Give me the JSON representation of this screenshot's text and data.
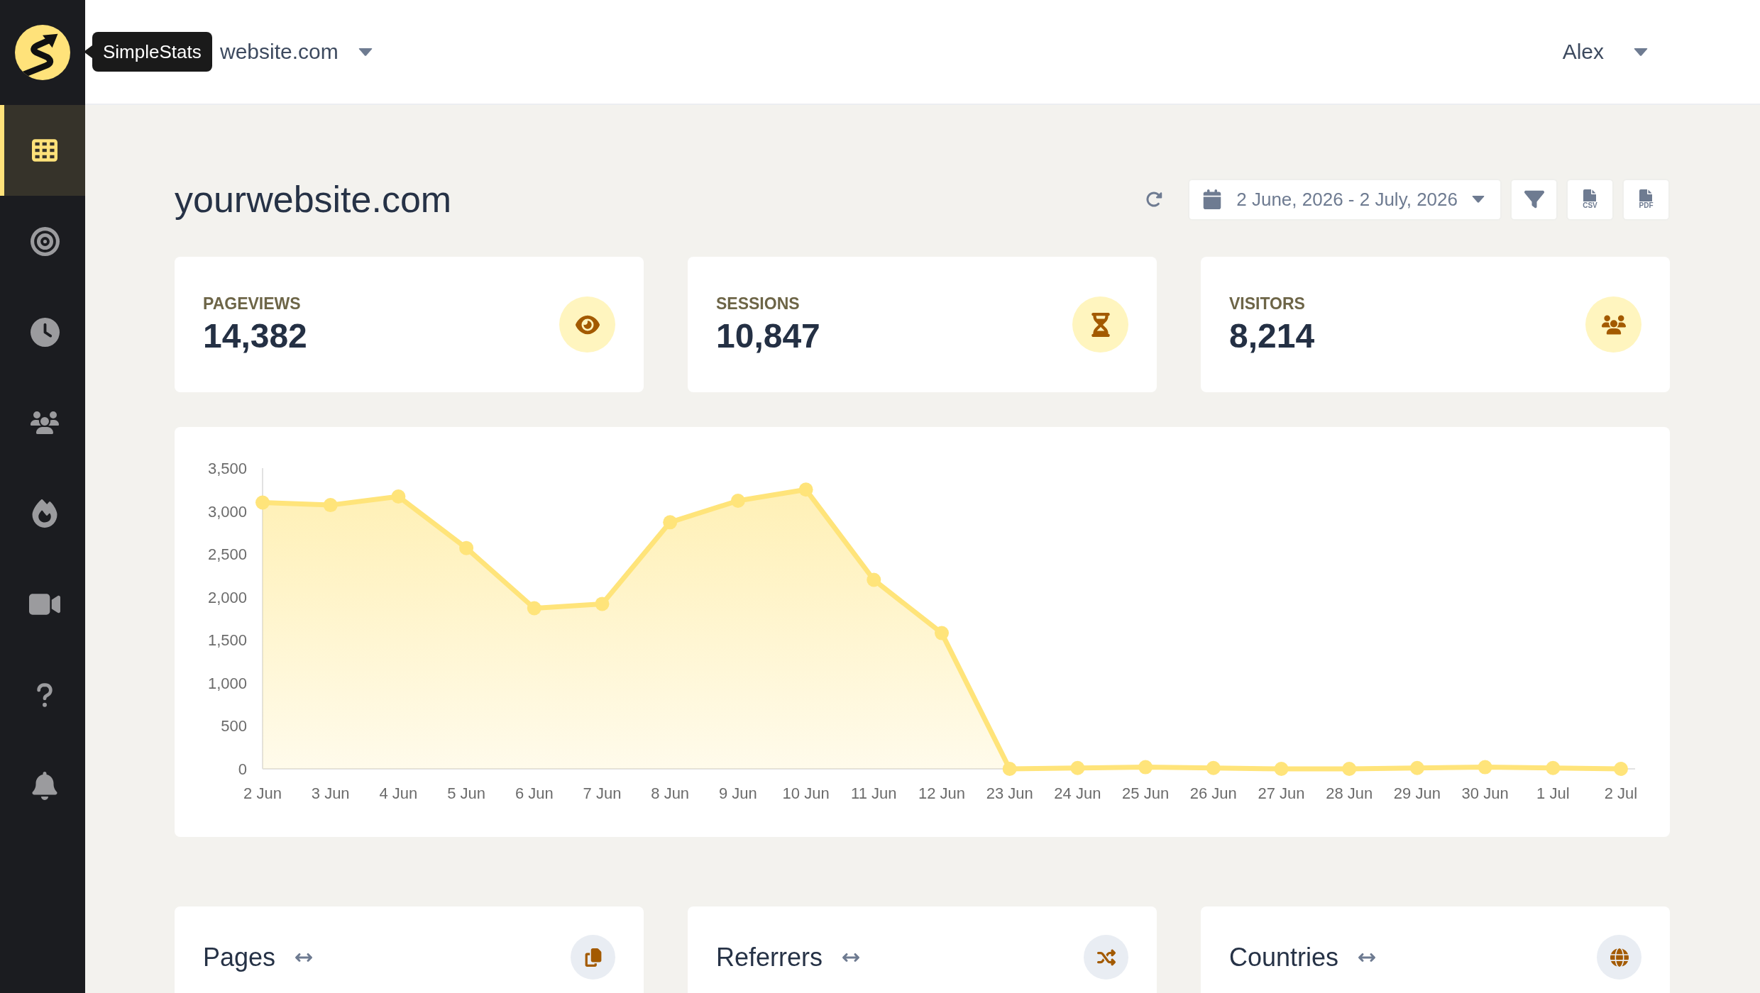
{
  "sidebar": {
    "logo_tooltip": "SimpleStats",
    "items": [
      {
        "selected": true
      },
      {
        "selected": false
      },
      {
        "selected": false
      },
      {
        "selected": false
      },
      {
        "selected": false
      },
      {
        "selected": false
      },
      {
        "selected": false
      },
      {
        "selected": false
      }
    ]
  },
  "header": {
    "site_selector": "website.com",
    "user": "Alex"
  },
  "page": {
    "title": "yourwebsite.com",
    "date_range": "2 June, 2026 - 2 July, 2026",
    "exports": [
      {
        "label": "CSV"
      },
      {
        "label": "PDF"
      }
    ]
  },
  "stats": [
    {
      "label": "PAGEVIEWS",
      "value": "14,382"
    },
    {
      "label": "SESSIONS",
      "value": "10,847"
    },
    {
      "label": "VISITORS",
      "value": "8,214"
    }
  ],
  "chart": {
    "chart_data": {
      "type": "area",
      "categories": [
        "2 Jun",
        "3 Jun",
        "4 Jun",
        "5 Jun",
        "6 Jun",
        "7 Jun",
        "8 Jun",
        "9 Jun",
        "10 Jun",
        "11 Jun",
        "12 Jun",
        "23 Jun",
        "24 Jun",
        "25 Jun",
        "26 Jun",
        "27 Jun",
        "28 Jun",
        "29 Jun",
        "30 Jun",
        "1 Jul",
        "2 Jul"
      ],
      "series": [
        {
          "color": "#ffe47a",
          "values": [
            3100,
            3070,
            3170,
            2570,
            1870,
            1920,
            2870,
            3120,
            3250,
            2200,
            1580,
            0,
            10,
            20,
            10,
            0,
            0,
            10,
            20,
            10,
            0
          ]
        }
      ],
      "ylim": [
        0,
        3500
      ],
      "yticks": [
        0,
        500,
        {
          "value": 1000,
          "label": "1,000"
        },
        {
          "value": 1500,
          "label": "1,500"
        },
        {
          "value": 2000,
          "label": "2,000"
        },
        {
          "value": 2500,
          "label": "2,500"
        },
        {
          "value": 3000,
          "label": "3,000"
        },
        {
          "value": 3500,
          "label": "3,500"
        }
      ]
    }
  },
  "panels": [
    {
      "title": "Pages"
    },
    {
      "title": "Referrers"
    },
    {
      "title": "Countries"
    }
  ]
}
